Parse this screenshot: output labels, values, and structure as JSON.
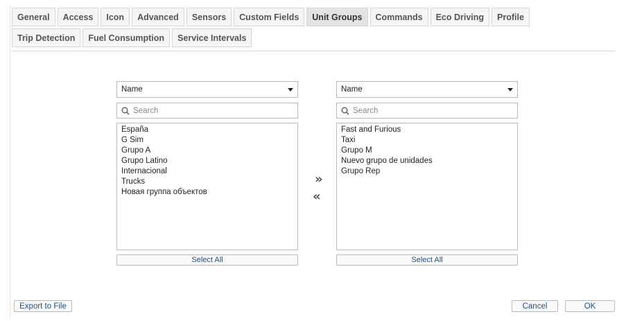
{
  "tabs": {
    "row1": [
      "General",
      "Access",
      "Icon",
      "Advanced",
      "Sensors",
      "Custom Fields",
      "Unit Groups",
      "Commands",
      "Eco Driving",
      "Profile"
    ],
    "row2": [
      "Trip Detection",
      "Fuel Consumption",
      "Service Intervals"
    ],
    "active": "Unit Groups"
  },
  "left_panel": {
    "sort_value": "Name",
    "search_placeholder": "Search",
    "items": [
      "España",
      "G Sim",
      "Grupo A",
      "Grupo Latino",
      "Internacional",
      "Trucks",
      "Новая группа объектов"
    ],
    "select_all": "Select All"
  },
  "right_panel": {
    "sort_value": "Name",
    "search_placeholder": "Search",
    "items": [
      "Fast and Furious",
      "Taxi",
      "Grupo M",
      "Nuevo grupo de unidades",
      "Grupo Rep"
    ],
    "select_all": "Select All"
  },
  "move": {
    "add": "»",
    "remove": "«"
  },
  "footer": {
    "export": "Export to File",
    "cancel": "Cancel",
    "ok": "OK"
  },
  "icons": {
    "search": "search-icon",
    "dropdown": "chevron-down-icon"
  }
}
